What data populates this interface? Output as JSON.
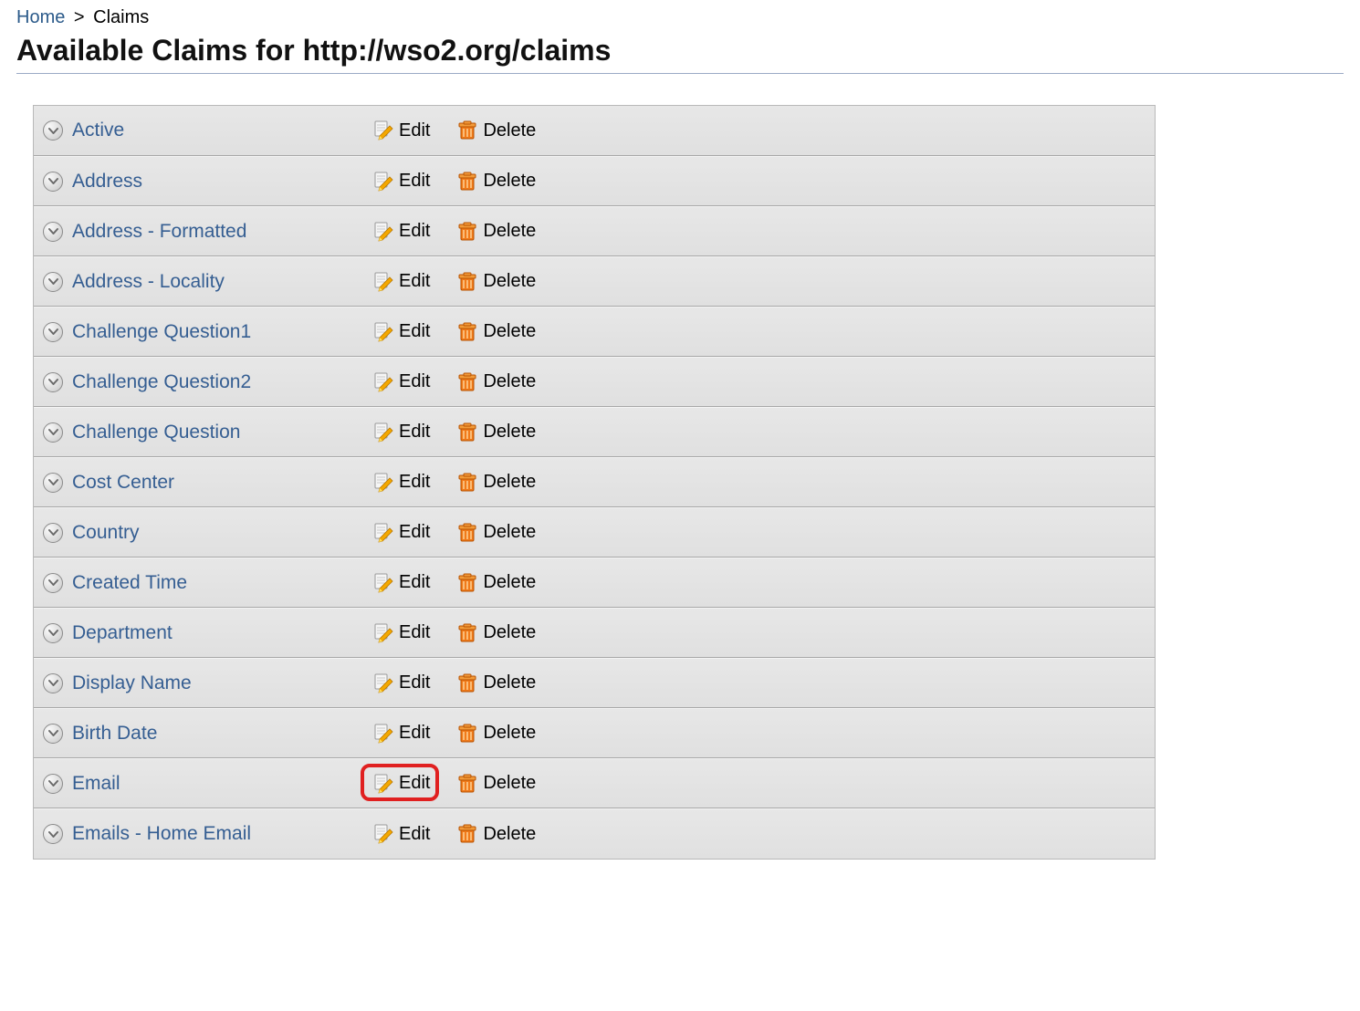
{
  "breadcrumb": {
    "home": "Home",
    "separator": ">",
    "current": "Claims"
  },
  "page_title": "Available Claims for http://wso2.org/claims",
  "actions": {
    "edit_label": "Edit",
    "delete_label": "Delete"
  },
  "claims": [
    {
      "name": "Active"
    },
    {
      "name": "Address"
    },
    {
      "name": "Address - Formatted"
    },
    {
      "name": "Address - Locality"
    },
    {
      "name": "Challenge Question1"
    },
    {
      "name": "Challenge Question2"
    },
    {
      "name": "Challenge Question"
    },
    {
      "name": "Cost Center"
    },
    {
      "name": "Country"
    },
    {
      "name": "Created Time"
    },
    {
      "name": "Department"
    },
    {
      "name": "Display Name"
    },
    {
      "name": "Birth Date"
    },
    {
      "name": "Email",
      "highlight_edit": true
    },
    {
      "name": "Emails - Home Email"
    }
  ]
}
